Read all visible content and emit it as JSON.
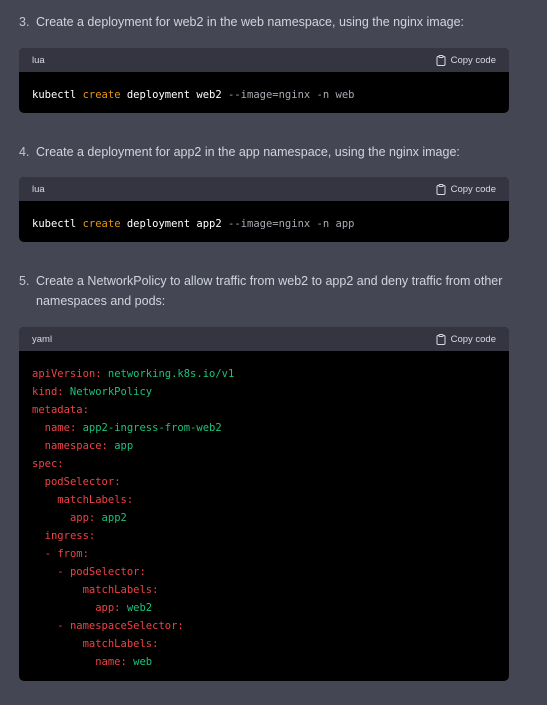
{
  "steps": [
    {
      "number": "3.",
      "text": "Create a deployment for web2 in the web namespace, using the nginx image:"
    },
    {
      "number": "4.",
      "text": "Create a deployment for app2 in the app namespace, using the nginx image:"
    },
    {
      "number": "5.",
      "text": "Create a NetworkPolicy to allow traffic from web2 to app2 and deny traffic from other namespaces and pods:"
    }
  ],
  "code_blocks": [
    {
      "language": "lua",
      "copy_label": "Copy code",
      "tokens": {
        "cmd": "kubectl",
        "verb": "create",
        "resource": "deployment",
        "name": "web2",
        "args": "--image=nginx -n web"
      }
    },
    {
      "language": "lua",
      "copy_label": "Copy code",
      "tokens": {
        "cmd": "kubectl",
        "verb": "create",
        "resource": "deployment",
        "name": "app2",
        "args": "--image=nginx -n app"
      }
    },
    {
      "language": "yaml",
      "copy_label": "Copy code",
      "lines": [
        {
          "indent": "",
          "dash": "",
          "key": "apiVersion:",
          "value": " networking.k8s.io/v1"
        },
        {
          "indent": "",
          "dash": "",
          "key": "kind:",
          "value": " NetworkPolicy"
        },
        {
          "indent": "",
          "dash": "",
          "key": "metadata:",
          "value": ""
        },
        {
          "indent": "  ",
          "dash": "",
          "key": "name:",
          "value": " app2-ingress-from-web2"
        },
        {
          "indent": "  ",
          "dash": "",
          "key": "namespace:",
          "value": " app"
        },
        {
          "indent": "",
          "dash": "",
          "key": "spec:",
          "value": ""
        },
        {
          "indent": "  ",
          "dash": "",
          "key": "podSelector:",
          "value": ""
        },
        {
          "indent": "    ",
          "dash": "",
          "key": "matchLabels:",
          "value": ""
        },
        {
          "indent": "      ",
          "dash": "",
          "key": "app:",
          "value": " app2"
        },
        {
          "indent": "  ",
          "dash": "",
          "key": "ingress:",
          "value": ""
        },
        {
          "indent": "  ",
          "dash": "- ",
          "key": "from:",
          "value": ""
        },
        {
          "indent": "    ",
          "dash": "- ",
          "key": "podSelector:",
          "value": ""
        },
        {
          "indent": "        ",
          "dash": "",
          "key": "matchLabels:",
          "value": ""
        },
        {
          "indent": "          ",
          "dash": "",
          "key": "app:",
          "value": " web2"
        },
        {
          "indent": "    ",
          "dash": "- ",
          "key": "namespaceSelector:",
          "value": ""
        },
        {
          "indent": "        ",
          "dash": "",
          "key": "matchLabels:",
          "value": ""
        },
        {
          "indent": "          ",
          "dash": "",
          "key": "name:",
          "value": " web"
        }
      ]
    }
  ],
  "colors": {
    "background": "#444654",
    "code_background": "#000000",
    "code_header": "#343541",
    "keyword": "#e9950c",
    "yaml_key": "#ef4146",
    "yaml_value": "#19c37d"
  },
  "icons": {
    "copy": "clipboard-icon"
  }
}
